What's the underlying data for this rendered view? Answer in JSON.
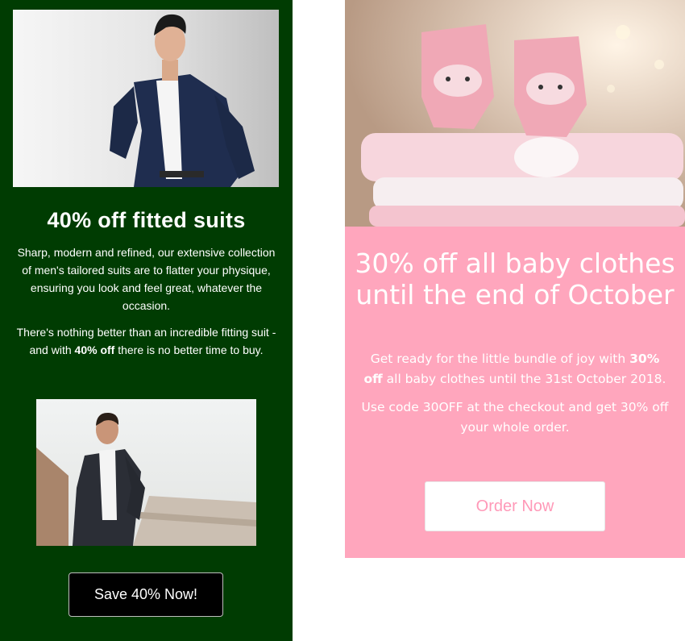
{
  "suits": {
    "title": "40% off fitted suits",
    "paragraph1": "Sharp, modern and refined, our extensive collection of men's tailored suits are to flatter your physique, ensuring you look and feel great, whatever the occasion.",
    "paragraph2_before": "There's nothing better than an incredible fitting suit - and with ",
    "paragraph2_bold": "40% off",
    "paragraph2_after": " there is no better time to buy.",
    "button_label": "Save 40% Now!",
    "background_color": "#003c02"
  },
  "baby": {
    "title": "30% off all baby clothes until the end of October",
    "paragraph1_bold": "30% off",
    "paragraph1_before": "Get ready for the little bundle of joy with ",
    "paragraph1_after": " all baby clothes until the 31st October 2018.",
    "paragraph2": "Use code 30OFF at the checkout and get 30% off your whole order.",
    "button_label": "Order Now",
    "background_color": "#ffa6bd",
    "button_text_color": "#ff99b8"
  }
}
